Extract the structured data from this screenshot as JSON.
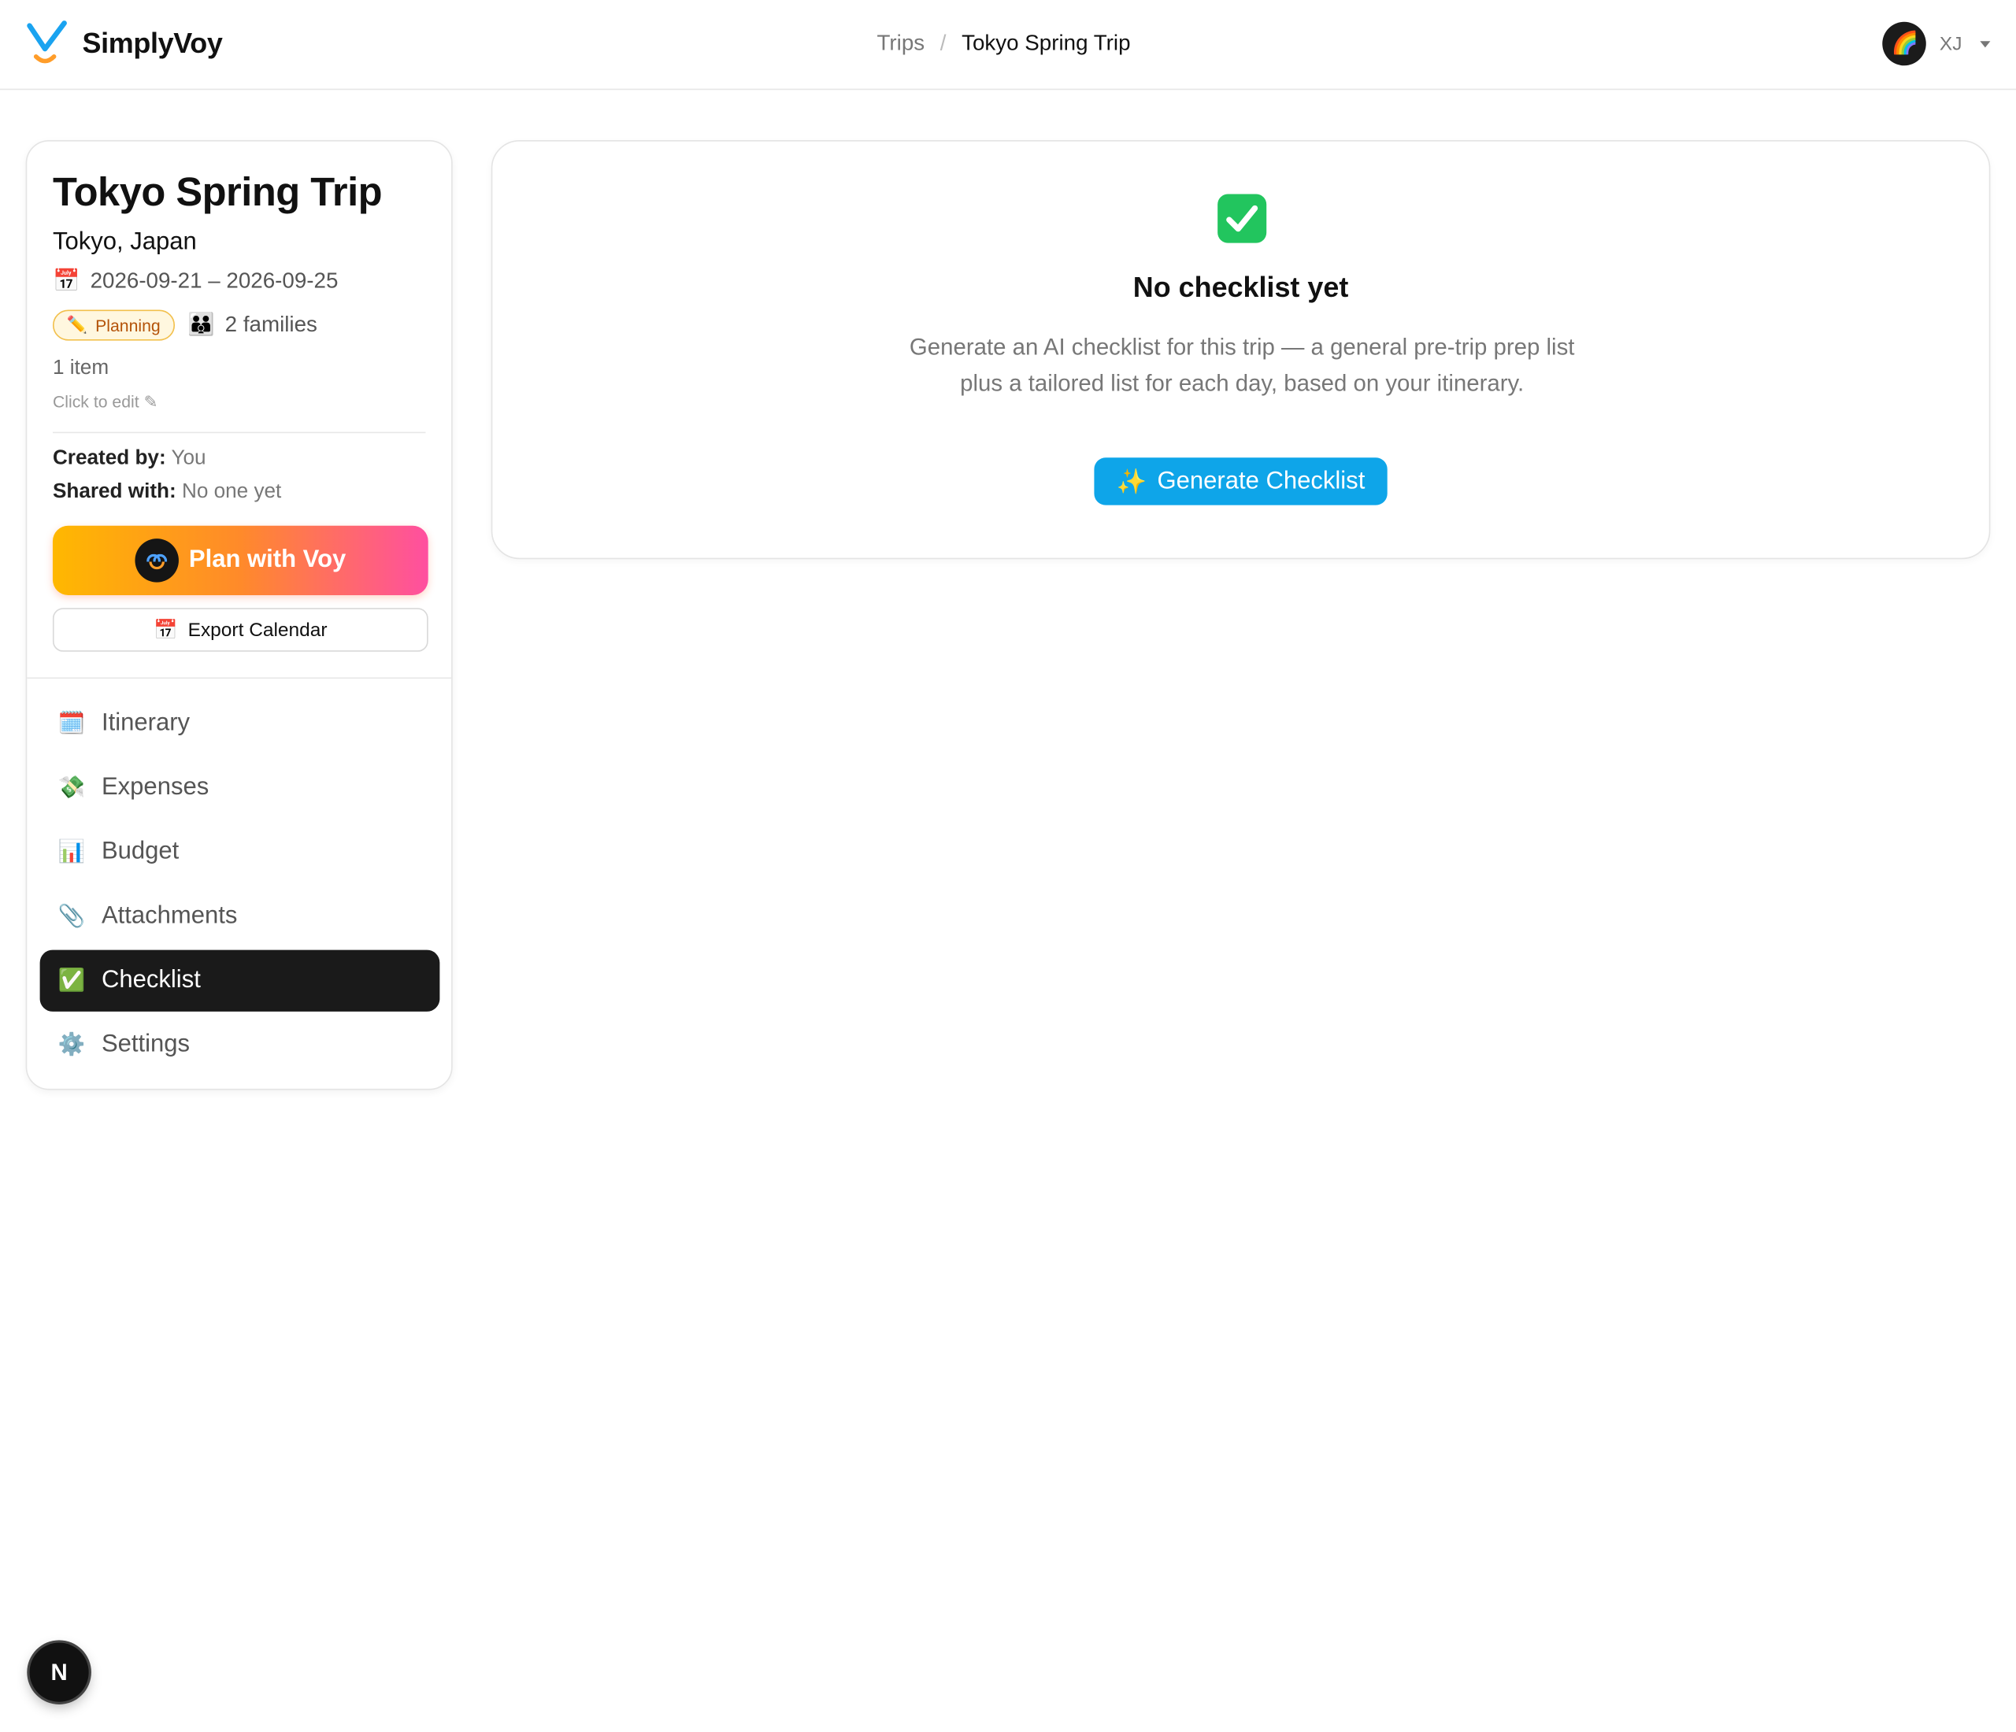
{
  "app": {
    "name": "SimplyVoy"
  },
  "breadcrumb": {
    "parent": "Trips",
    "separator": "/",
    "current": "Tokyo Spring Trip"
  },
  "user": {
    "initials": "XJ",
    "avatar_glyph": "🌈"
  },
  "trip": {
    "title": "Tokyo Spring Trip",
    "location": "Tokyo, Japan",
    "dates_icon": "📅",
    "dates": "2026-09-21 – 2026-09-25",
    "status_icon": "✏️",
    "status": "Planning",
    "families_icon": "👪",
    "families": "2 families",
    "item_count": "1 item",
    "click_to_edit": "Click to edit ✎",
    "created_by_label": "Created by:",
    "created_by": "You",
    "shared_with_label": "Shared with:",
    "shared_with": "No one yet"
  },
  "actions": {
    "plan_with_voy": "Plan with Voy",
    "export_calendar_icon": "📅",
    "export_calendar": "Export Calendar"
  },
  "nav": {
    "items": [
      {
        "icon": "🗓️",
        "icon_name": "calendar-icon",
        "label": "Itinerary"
      },
      {
        "icon": "💸",
        "icon_name": "money-icon",
        "label": "Expenses"
      },
      {
        "icon": "📊",
        "icon_name": "bar-chart-icon",
        "label": "Budget"
      },
      {
        "icon": "📎",
        "icon_name": "paperclip-icon",
        "label": "Attachments"
      },
      {
        "icon": "✅",
        "icon_name": "checkmark-icon",
        "label": "Checklist",
        "active": true
      },
      {
        "icon": "⚙️",
        "icon_name": "gear-icon",
        "label": "Settings"
      }
    ]
  },
  "checklist": {
    "empty_title": "No checklist yet",
    "empty_description": "Generate an AI checklist for this trip — a general pre-trip prep list plus a tailored list for each day, based on your itinerary.",
    "generate_icon": "✨",
    "generate_label": "Generate Checklist"
  },
  "dev_badge": {
    "label": "N"
  },
  "colors": {
    "accent_blue": "#0ea5e9",
    "plan_gradient_start": "#ffb800",
    "plan_gradient_end": "#ff4fa0",
    "active_nav_bg": "#1a1a1a",
    "status_badge_text": "#b45309"
  }
}
